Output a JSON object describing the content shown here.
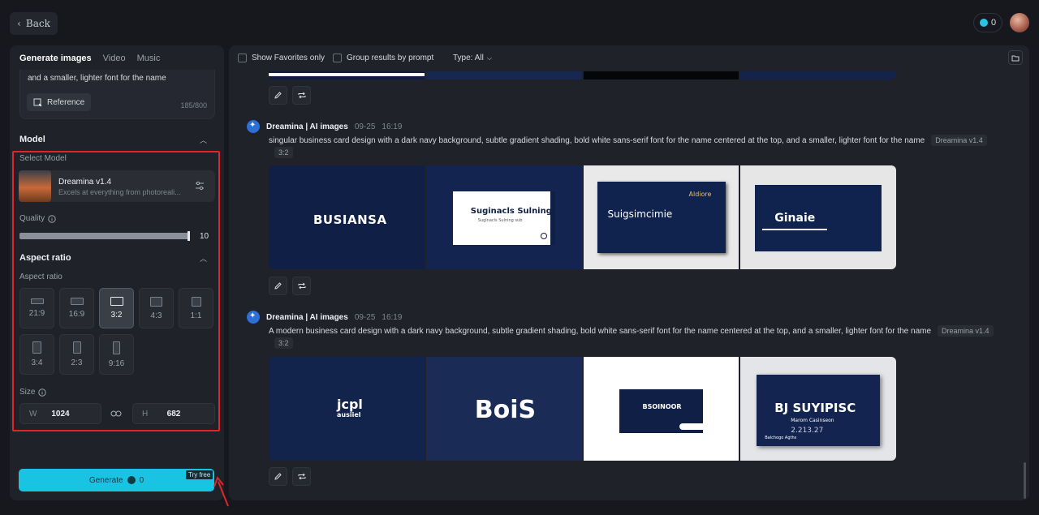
{
  "header": {
    "back_label": "Back",
    "credits": "0"
  },
  "left": {
    "tabs": [
      "Generate images",
      "Video",
      "Music"
    ],
    "prompt_tail": "and a smaller, lighter font for the name",
    "reference_label": "Reference",
    "char_count": "185/800",
    "model_section": "Model",
    "select_model_label": "Select Model",
    "model_name": "Dreamina v1.4",
    "model_desc": "Excels at everything from photoreali...",
    "quality_label": "Quality",
    "quality_value": "10",
    "quality_fraction": 1.0,
    "aspect_section": "Aspect ratio",
    "aspect_label": "Aspect ratio",
    "ratios": [
      "21:9",
      "16:9",
      "3:2",
      "4:3",
      "1:1",
      "3:4",
      "2:3",
      "9:16"
    ],
    "selected_ratio": "3:2",
    "size_label": "Size",
    "width_key": "W",
    "width_value": "1024",
    "height_key": "H",
    "height_value": "682",
    "generate_label": "Generate",
    "generate_cost": "0",
    "try_free": "Try free"
  },
  "main": {
    "show_favorites": "Show Favorites only",
    "group_by_prompt": "Group results by prompt",
    "type_filter": "Type: All",
    "entries": [
      {
        "source": "Dreamina | AI images",
        "date": "09-25",
        "time": "16:19",
        "prompt": "singular business card design with a dark navy background, subtle gradient shading, bold white sans-serif font for the name centered at the top, and a smaller, lighter font for the name",
        "model_chip": "Dreamina v1.4",
        "ratio_chip": "3:2",
        "tiles": [
          "BUSIANSA",
          "Suginacls Sulning",
          "Suginacls Sulning sub",
          "Suigsimcimie",
          "Aldiore",
          "Ginaie"
        ]
      },
      {
        "source": "Dreamina | AI images",
        "date": "09-25",
        "time": "16:19",
        "prompt": "A modern business card design with a dark navy background, subtle gradient shading, bold white sans-serif font for the name centered at the top, and a smaller, lighter font for the name",
        "model_chip": "Dreamina v1.4",
        "ratio_chip": "3:2",
        "tiles": [
          "jcpl",
          "ausiiel",
          "BoiS",
          "BSOINOOR",
          "BJ SUYIPISC",
          "Marom Casinseon",
          "2.213.27",
          "Balchogo Agths"
        ]
      }
    ]
  },
  "colors": {
    "accent": "#19c4e3",
    "highlight": "#e0242c",
    "navy": "#0f1f45"
  }
}
